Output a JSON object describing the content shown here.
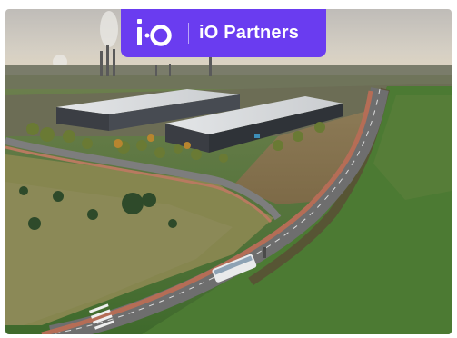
{
  "image": {
    "subject": "aerial-photo-industrial-logistics-park",
    "colors": {
      "sky": "#c7c3bd",
      "field": "#5a7a3a",
      "road": "#6d6d6d",
      "bike_lane": "#b56d56",
      "warehouse_roof": "#d9dadb",
      "warehouse_wall": "#3a3d42"
    }
  },
  "brand_badge": {
    "logo_icon": "io-logo-icon",
    "name": "iO Partners",
    "background_color": "#6a3cf0",
    "text_color": "#ffffff"
  }
}
